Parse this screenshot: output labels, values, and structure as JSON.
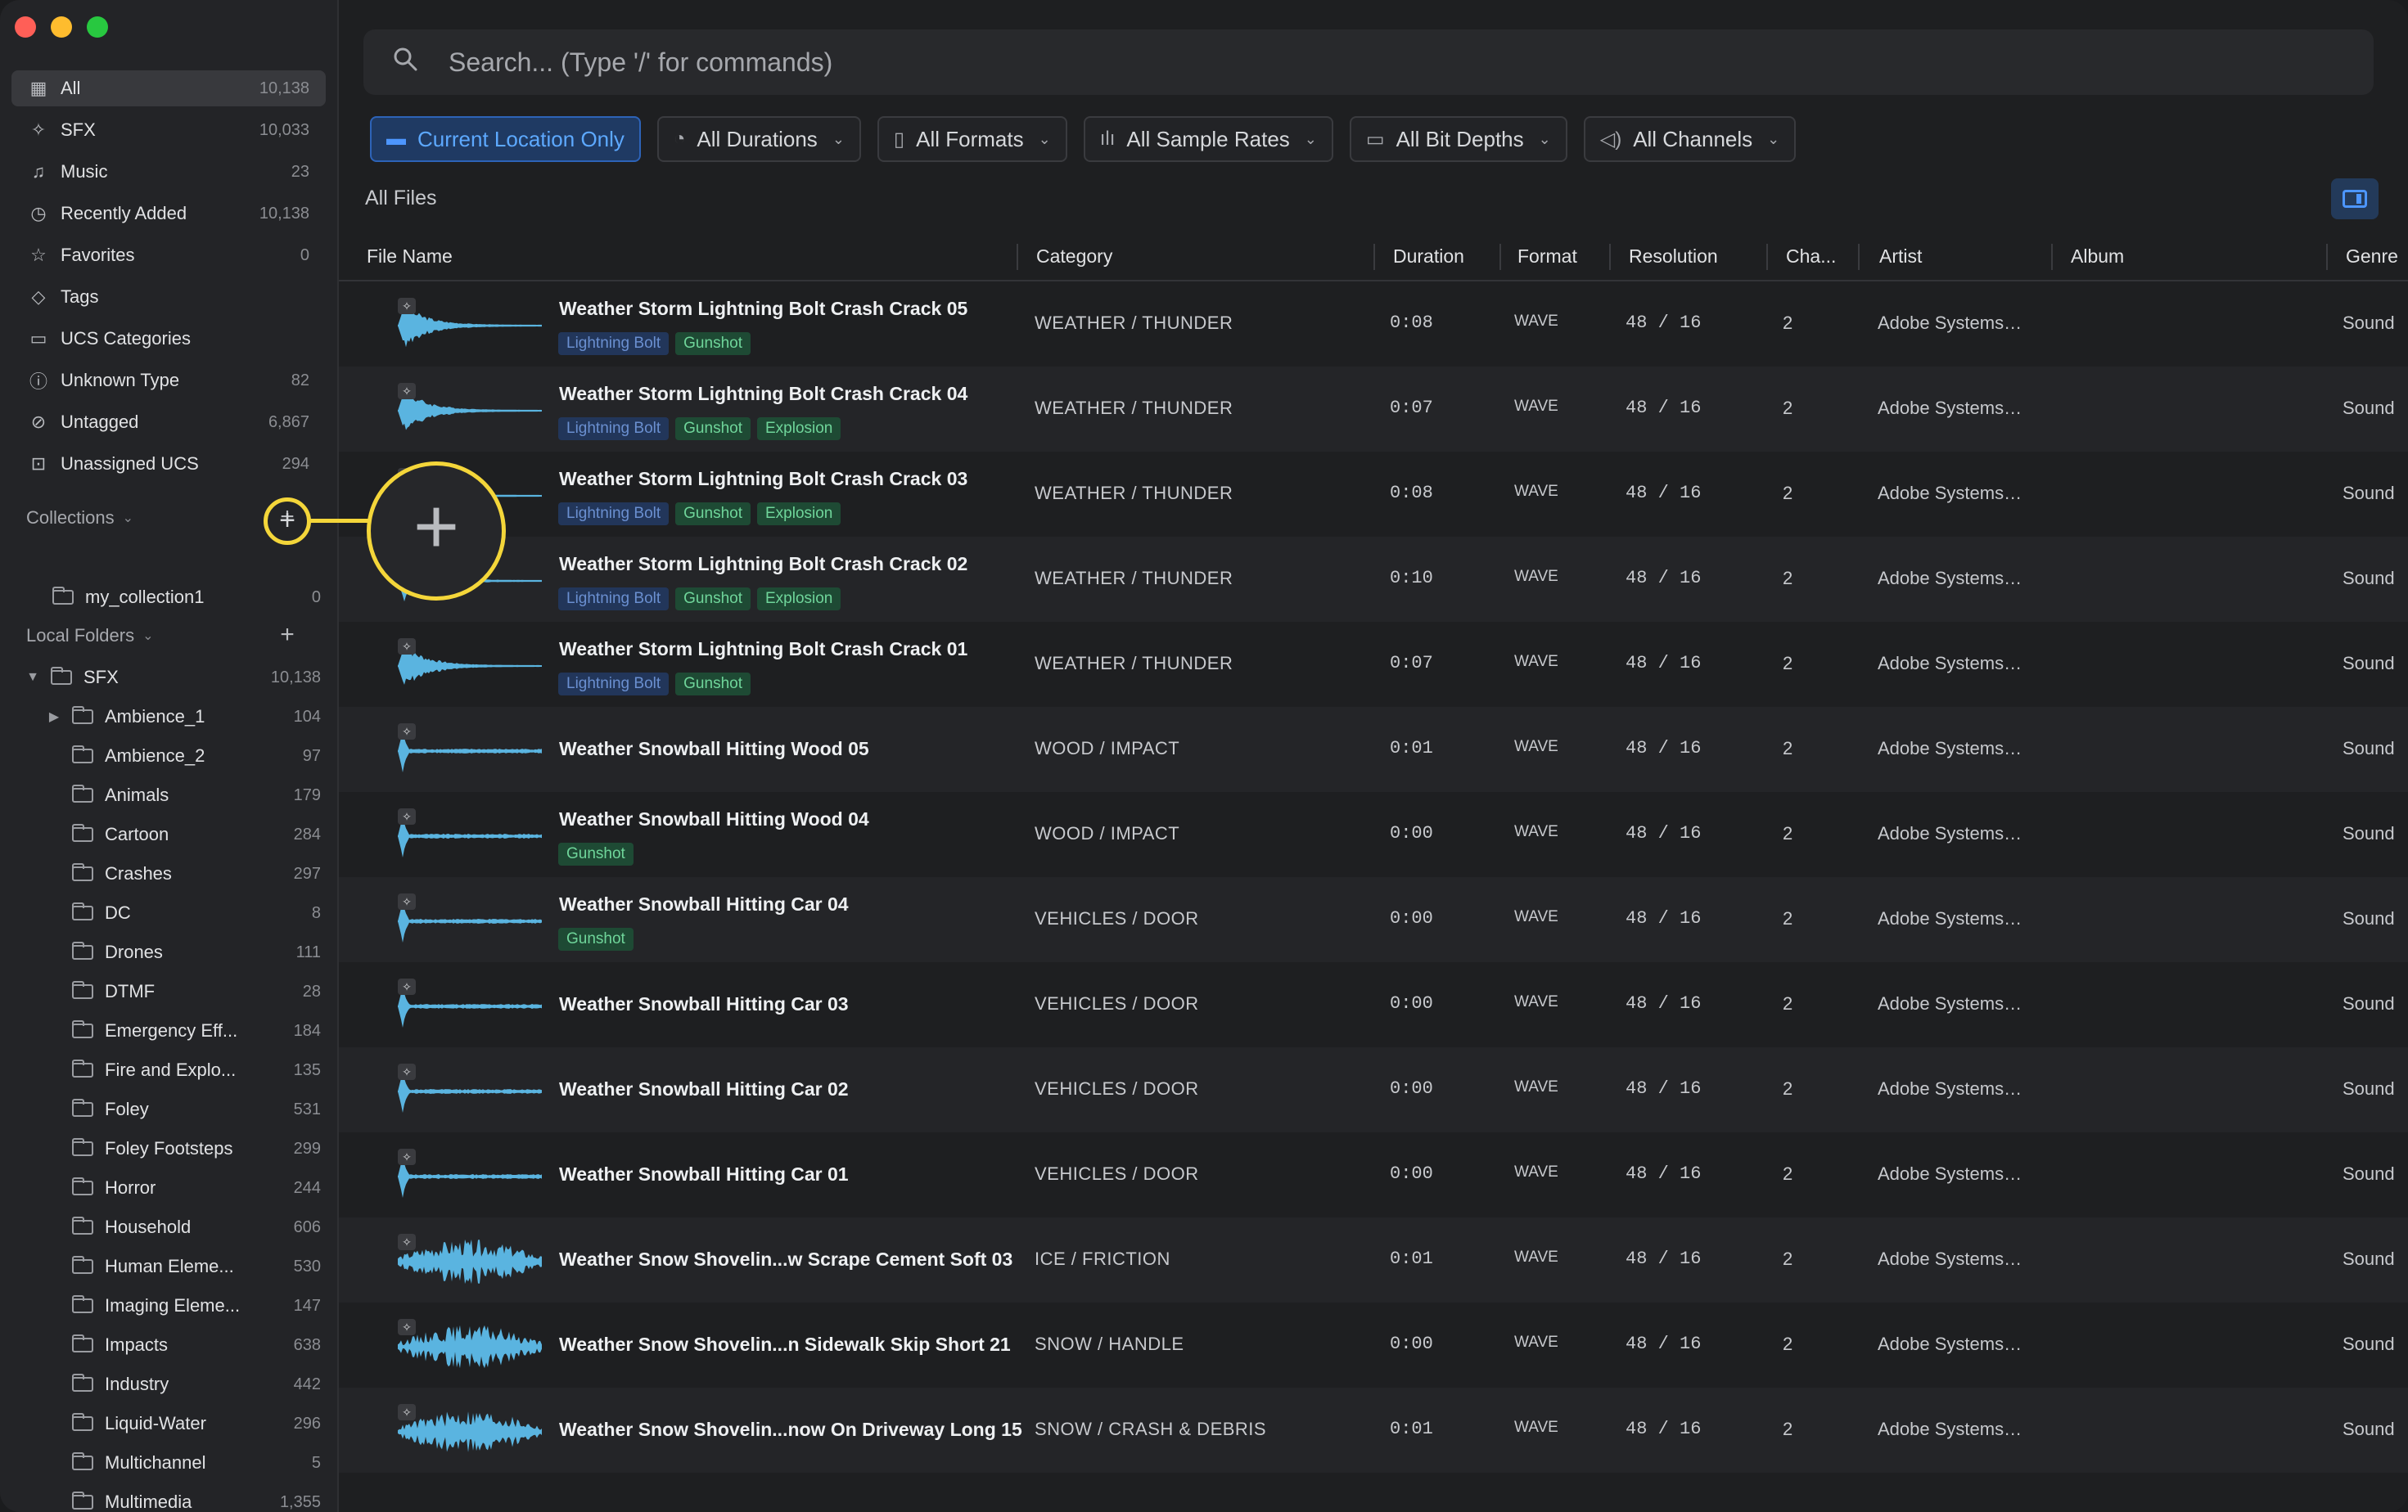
{
  "sidebar": {
    "nav": [
      {
        "label": "All",
        "count": "10,138",
        "icon": "grid-icon"
      },
      {
        "label": "SFX",
        "count": "10,033",
        "icon": "sparkle-icon"
      },
      {
        "label": "Music",
        "count": "23",
        "icon": "music-note-icon"
      },
      {
        "label": "Recently Added",
        "count": "10,138",
        "icon": "clock-icon"
      },
      {
        "label": "Favorites",
        "count": "0",
        "icon": "star-icon"
      },
      {
        "label": "Tags",
        "count": "",
        "icon": "tag-icon"
      },
      {
        "label": "UCS Categories",
        "count": "",
        "icon": "folder-tree-icon"
      },
      {
        "label": "Unknown Type",
        "count": "82",
        "icon": "question-icon"
      },
      {
        "label": "Untagged",
        "count": "6,867",
        "icon": "untag-icon"
      },
      {
        "label": "Unassigned UCS",
        "count": "294",
        "icon": "unassigned-icon"
      }
    ],
    "collections_label": "Collections",
    "collections": [
      {
        "label": "my_collection1",
        "count": "0"
      }
    ],
    "local_folders_label": "Local Folders",
    "root_folder": {
      "label": "SFX",
      "count": "10,138"
    },
    "folders": [
      {
        "label": "Ambience_1",
        "count": "104",
        "expandable": true
      },
      {
        "label": "Ambience_2",
        "count": "97"
      },
      {
        "label": "Animals",
        "count": "179"
      },
      {
        "label": "Cartoon",
        "count": "284"
      },
      {
        "label": "Crashes",
        "count": "297"
      },
      {
        "label": "DC",
        "count": "8"
      },
      {
        "label": "Drones",
        "count": "111"
      },
      {
        "label": "DTMF",
        "count": "28"
      },
      {
        "label": "Emergency Eff...",
        "count": "184"
      },
      {
        "label": "Fire and Explo...",
        "count": "135"
      },
      {
        "label": "Foley",
        "count": "531"
      },
      {
        "label": "Foley Footsteps",
        "count": "299"
      },
      {
        "label": "Horror",
        "count": "244"
      },
      {
        "label": "Household",
        "count": "606"
      },
      {
        "label": "Human Eleme...",
        "count": "530"
      },
      {
        "label": "Imaging Eleme...",
        "count": "147"
      },
      {
        "label": "Impacts",
        "count": "638"
      },
      {
        "label": "Industry",
        "count": "442"
      },
      {
        "label": "Liquid-Water",
        "count": "296"
      },
      {
        "label": "Multichannel",
        "count": "5"
      },
      {
        "label": "Multimedia",
        "count": "1,355"
      }
    ]
  },
  "search": {
    "placeholder": "Search... (Type '/' for commands)"
  },
  "filters": [
    {
      "label": "Current Location Only",
      "icon": "folder-icon",
      "primary": true
    },
    {
      "label": "All Durations",
      "icon": "stopwatch-icon"
    },
    {
      "label": "All Formats",
      "icon": "file-icon"
    },
    {
      "label": "All Sample Rates",
      "icon": "waveform-icon"
    },
    {
      "label": "All Bit Depths",
      "icon": "bit-depth-icon"
    },
    {
      "label": "All Channels",
      "icon": "speaker-icon"
    }
  ],
  "view_title": "All Files",
  "columns": {
    "file_name": "File Name",
    "category": "Category",
    "duration": "Duration",
    "format": "Format",
    "resolution": "Resolution",
    "channels": "Cha...",
    "artist": "Artist",
    "album": "Album",
    "genre": "Genre"
  },
  "files": [
    {
      "name": "Weather Storm Lightning Bolt Crash Crack 05",
      "tags": [
        "Lightning Bolt",
        "Gunshot"
      ],
      "category": "WEATHER / THUNDER",
      "duration": "0:08",
      "format": "WAVE",
      "resolution": "48 / 16",
      "channels": "2",
      "artist": "Adobe Systems…",
      "genre": "Sound",
      "wave": "burst"
    },
    {
      "name": "Weather Storm Lightning Bolt Crash Crack 04",
      "tags": [
        "Lightning Bolt",
        "Gunshot",
        "Explosion"
      ],
      "category": "WEATHER / THUNDER",
      "duration": "0:07",
      "format": "WAVE",
      "resolution": "48 / 16",
      "channels": "2",
      "artist": "Adobe Systems…",
      "genre": "Sound",
      "wave": "burst"
    },
    {
      "name": "Weather Storm Lightning Bolt Crash Crack 03",
      "tags": [
        "Lightning Bolt",
        "Gunshot",
        "Explosion"
      ],
      "category": "WEATHER / THUNDER",
      "duration": "0:08",
      "format": "WAVE",
      "resolution": "48 / 16",
      "channels": "2",
      "artist": "Adobe Systems…",
      "genre": "Sound",
      "wave": "burst"
    },
    {
      "name": "Weather Storm Lightning Bolt Crash Crack 02",
      "tags": [
        "Lightning Bolt",
        "Gunshot",
        "Explosion"
      ],
      "category": "WEATHER / THUNDER",
      "duration": "0:10",
      "format": "WAVE",
      "resolution": "48 / 16",
      "channels": "2",
      "artist": "Adobe Systems…",
      "genre": "Sound",
      "wave": "burst"
    },
    {
      "name": "Weather Storm Lightning Bolt Crash Crack 01",
      "tags": [
        "Lightning Bolt",
        "Gunshot"
      ],
      "category": "WEATHER / THUNDER",
      "duration": "0:07",
      "format": "WAVE",
      "resolution": "48 / 16",
      "channels": "2",
      "artist": "Adobe Systems…",
      "genre": "Sound",
      "wave": "burst"
    },
    {
      "name": "Weather Snowball Hitting Wood 05",
      "tags": [],
      "category": "WOOD / IMPACT",
      "duration": "0:01",
      "format": "WAVE",
      "resolution": "48 / 16",
      "channels": "2",
      "artist": "Adobe Systems…",
      "genre": "Sound",
      "wave": "spike"
    },
    {
      "name": "Weather Snowball Hitting Wood 04",
      "tags": [
        "Gunshot"
      ],
      "category": "WOOD / IMPACT",
      "duration": "0:00",
      "format": "WAVE",
      "resolution": "48 / 16",
      "channels": "2",
      "artist": "Adobe Systems…",
      "genre": "Sound",
      "wave": "spike"
    },
    {
      "name": "Weather Snowball Hitting Car 04",
      "tags": [
        "Gunshot"
      ],
      "category": "VEHICLES / DOOR",
      "duration": "0:00",
      "format": "WAVE",
      "resolution": "48 / 16",
      "channels": "2",
      "artist": "Adobe Systems…",
      "genre": "Sound",
      "wave": "spike"
    },
    {
      "name": "Weather Snowball Hitting Car 03",
      "tags": [],
      "category": "VEHICLES / DOOR",
      "duration": "0:00",
      "format": "WAVE",
      "resolution": "48 / 16",
      "channels": "2",
      "artist": "Adobe Systems…",
      "genre": "Sound",
      "wave": "spike"
    },
    {
      "name": "Weather Snowball Hitting Car 02",
      "tags": [],
      "category": "VEHICLES / DOOR",
      "duration": "0:00",
      "format": "WAVE",
      "resolution": "48 / 16",
      "channels": "2",
      "artist": "Adobe Systems…",
      "genre": "Sound",
      "wave": "spike"
    },
    {
      "name": "Weather Snowball Hitting Car 01",
      "tags": [],
      "category": "VEHICLES / DOOR",
      "duration": "0:00",
      "format": "WAVE",
      "resolution": "48 / 16",
      "channels": "2",
      "artist": "Adobe Systems…",
      "genre": "Sound",
      "wave": "spike"
    },
    {
      "name": "Weather Snow Shovelin...w Scrape Cement Soft 03",
      "tags": [],
      "category": "ICE / FRICTION",
      "duration": "0:01",
      "format": "WAVE",
      "resolution": "48 / 16",
      "channels": "2",
      "artist": "Adobe Systems…",
      "genre": "Sound",
      "wave": "noise"
    },
    {
      "name": "Weather Snow Shovelin...n Sidewalk Skip Short 21",
      "tags": [],
      "category": "SNOW / HANDLE",
      "duration": "0:00",
      "format": "WAVE",
      "resolution": "48 / 16",
      "channels": "2",
      "artist": "Adobe Systems…",
      "genre": "Sound",
      "wave": "noise"
    },
    {
      "name": "Weather Snow Shovelin...now On Driveway Long 15",
      "tags": [],
      "category": "SNOW / CRASH & DEBRIS",
      "duration": "0:01",
      "format": "WAVE",
      "resolution": "48 / 16",
      "channels": "2",
      "artist": "Adobe Systems…",
      "genre": "Sound",
      "wave": "noise"
    }
  ],
  "tag_colors": {
    "Lightning Bolt": "blue",
    "Gunshot": "green",
    "Explosion": "green"
  },
  "colors": {
    "accent": "#4d96ff",
    "waveform": "#5ab4e0",
    "highlight": "#f4d63a"
  },
  "highlight_icon": "plus-icon"
}
